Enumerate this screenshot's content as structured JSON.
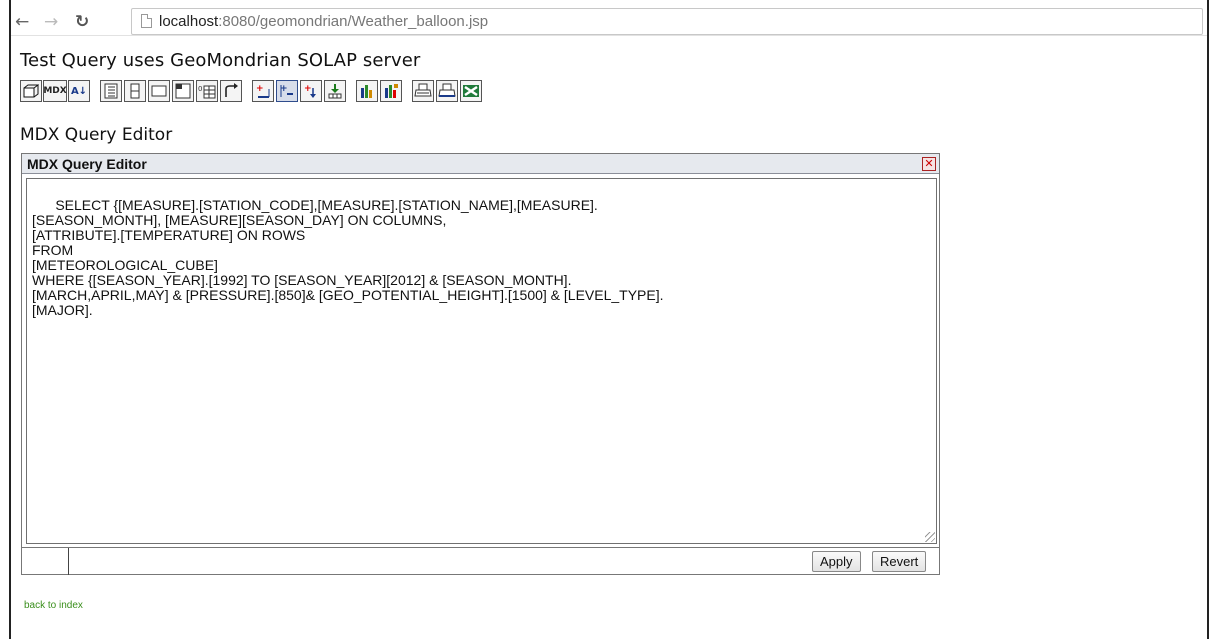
{
  "browser": {
    "back_icon": "back-arrow-icon",
    "forward_icon": "forward-arrow-icon",
    "reload_icon": "reload-icon",
    "url_host": "localhost",
    "url_rest": ":8080/geomondrian/Weather_balloon.jsp"
  },
  "page": {
    "title": "Test Query uses GeoMondrian SOLAP server",
    "section_title": "MDX Query Editor"
  },
  "toolbar": {
    "mdx_label": "MDX",
    "icons": [
      "cube-icon",
      "mdx-icon",
      "sort-icon",
      "hierarchy-icon",
      "table-icon",
      "window-icon",
      "properties-icon",
      "grid-icon",
      "swap-axes-icon",
      "drill-member-icon",
      "drill-position-icon",
      "drill-replace-icon",
      "drill-through-icon",
      "chart-icon",
      "chart-config-icon",
      "print-icon",
      "print-config-icon",
      "excel-export-icon"
    ]
  },
  "editor": {
    "title": "MDX Query Editor",
    "close_label": "✕",
    "query": "SELECT {[MEASURE].[STATION_CODE],[MEASURE].[STATION_NAME],[MEASURE].\n[SEASON_MONTH], [MEASURE][SEASON_DAY] ON COLUMNS,\n[ATTRIBUTE].[TEMPERATURE] ON ROWS\nFROM\n[METEOROLOGICAL_CUBE]\nWHERE {[SEASON_YEAR].[1992] TO [SEASON_YEAR][2012] & [SEASON_MONTH].\n[MARCH,APRIL,MAY] & [PRESSURE].[850]& [GEO_POTENTIAL_HEIGHT].[1500] & [LEVEL_TYPE].\n[MAJOR].",
    "apply_label": "Apply",
    "revert_label": "Revert"
  },
  "footer": {
    "back_link": "back to index"
  }
}
